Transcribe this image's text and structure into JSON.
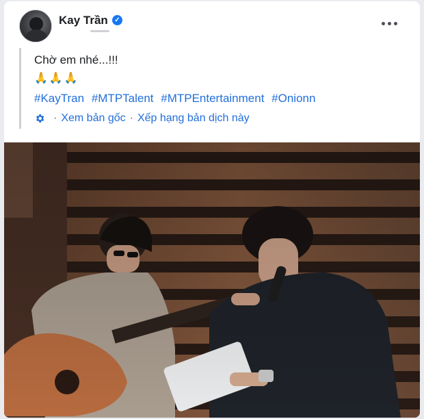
{
  "post": {
    "author": "Kay Trần",
    "verified_icon": "verified-check-icon",
    "more_icon": "more-options-icon",
    "text": "Chờ em nhé...!!!",
    "emoji": "🙏🙏🙏",
    "hashtags": [
      "#KayTran",
      "#MTPTalent",
      "#MTPEntertainment",
      "#Onionn"
    ],
    "translate": {
      "icon": "gear-icon",
      "separator": "·",
      "see_original": "Xem bản gốc",
      "rate_translation": "Xếp hạng bản dịch này"
    },
    "photo_icon": "studio-photo"
  },
  "colors": {
    "link": "#216fdb",
    "verified": "#1877f2",
    "text": "#1c1e21"
  }
}
